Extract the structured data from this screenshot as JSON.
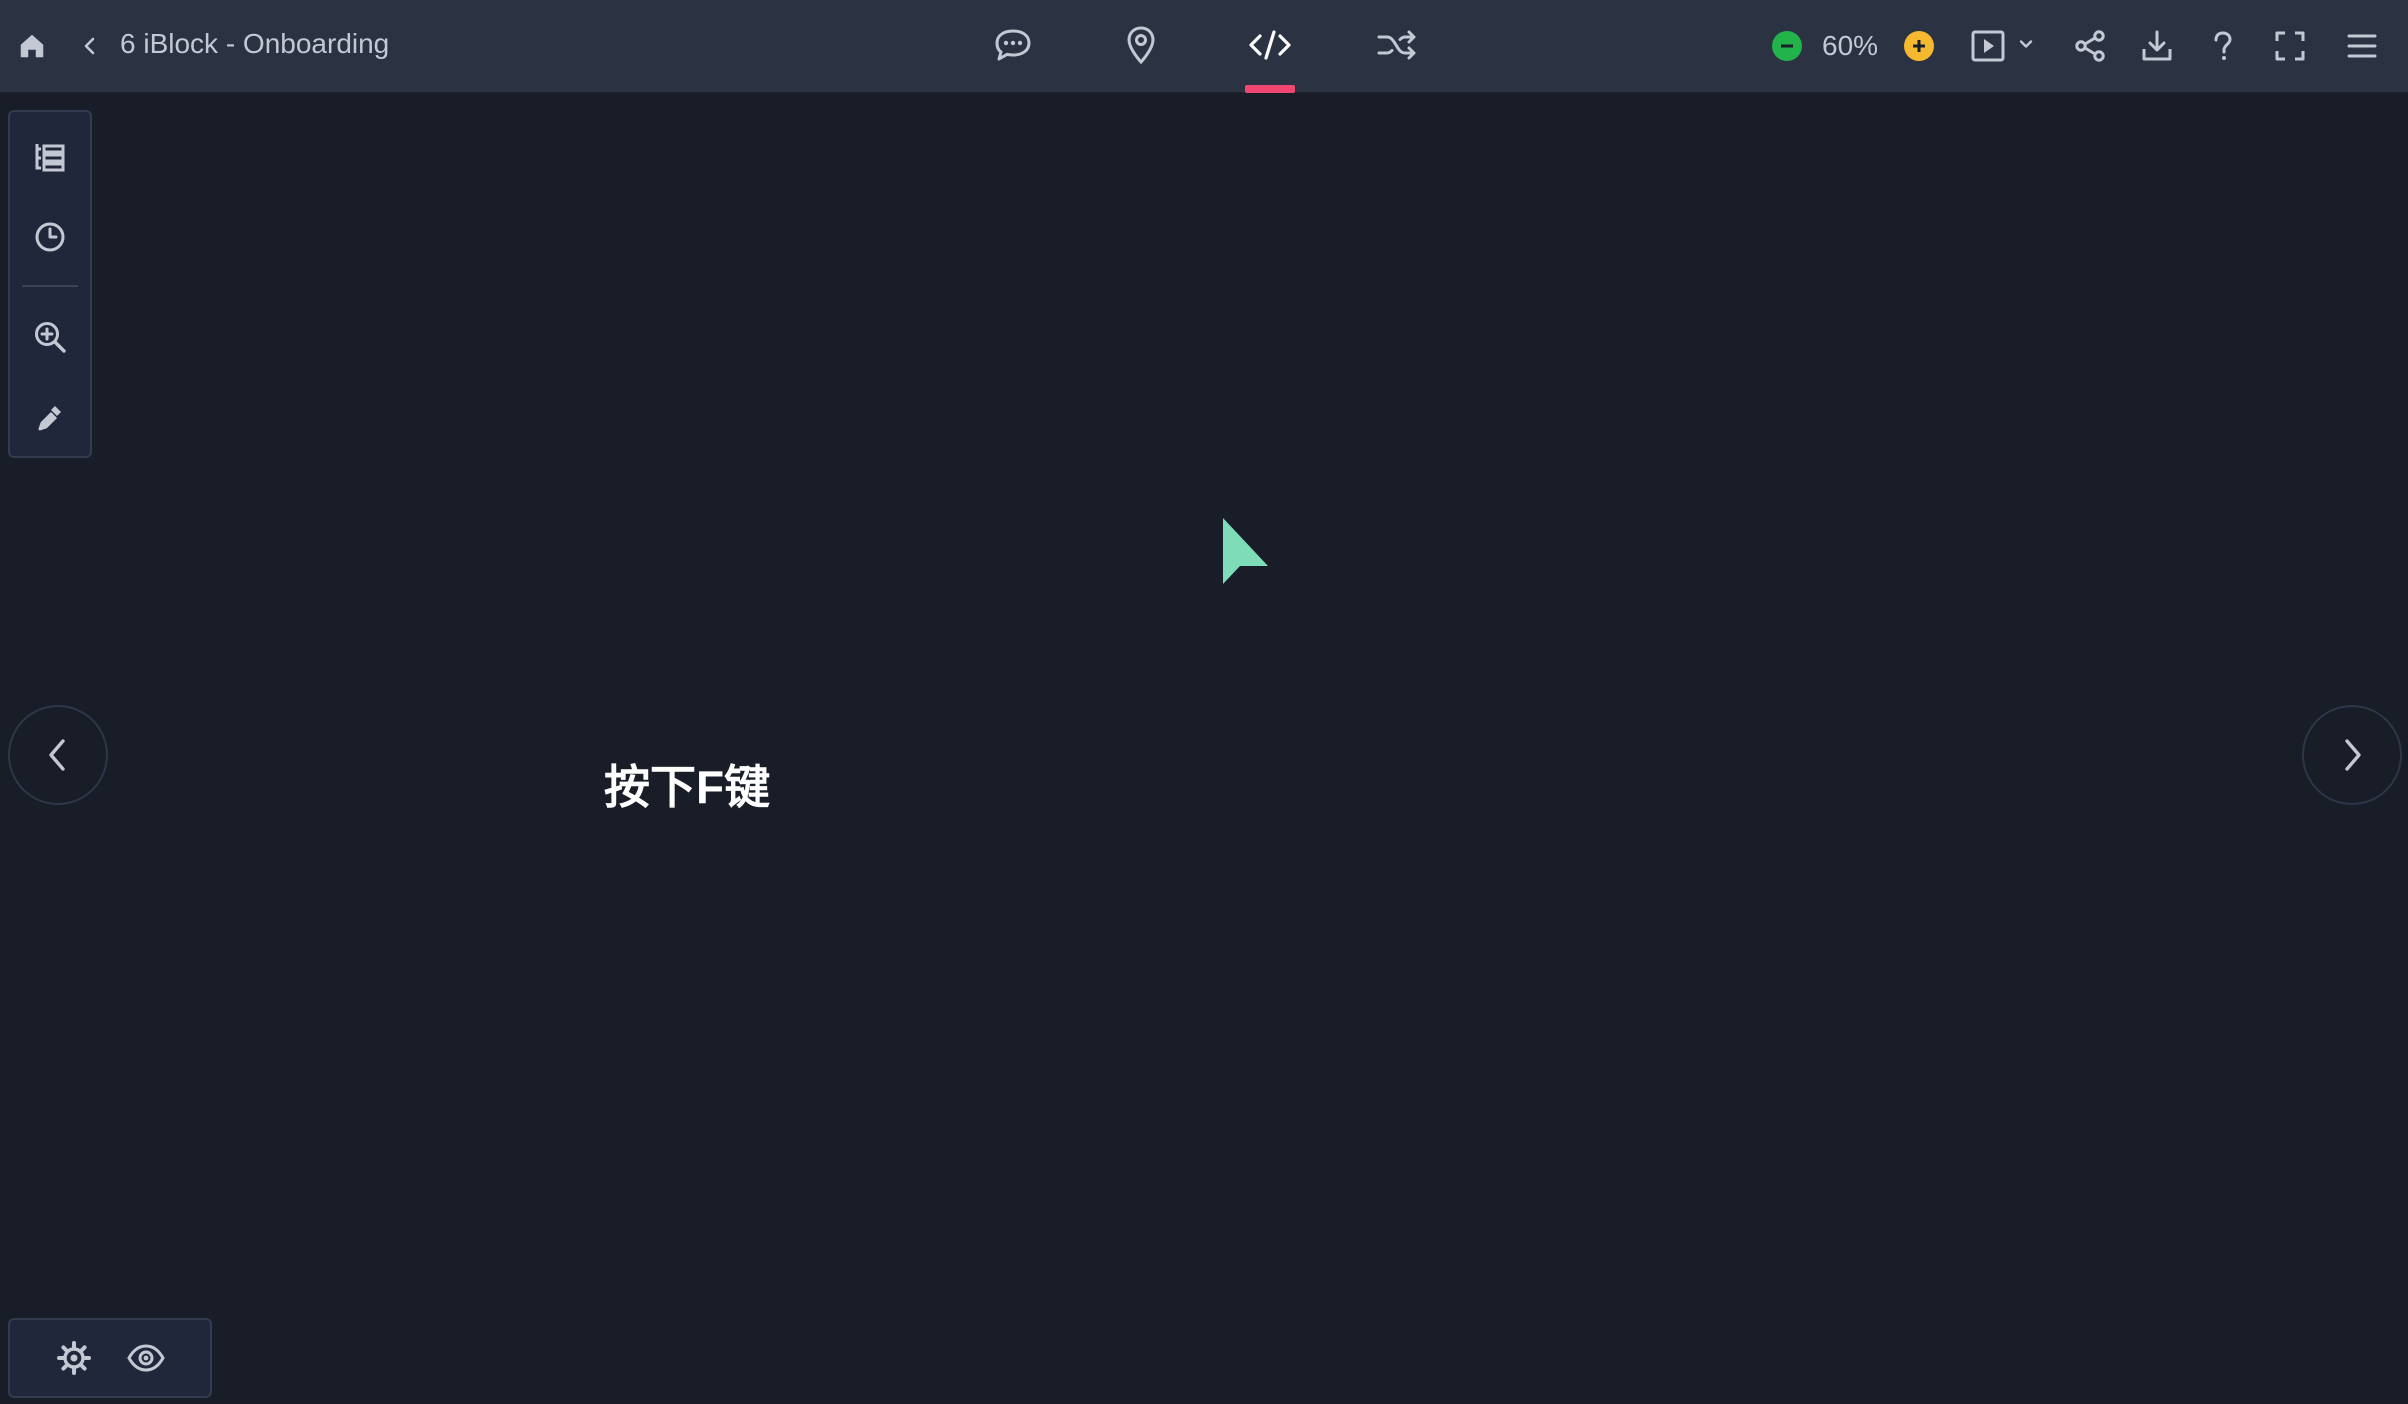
{
  "header": {
    "home_icon": "home-icon",
    "back_icon": "chevron-left-icon",
    "title": "6 iBlock - Onboarding",
    "tabs": [
      {
        "icon": "comment-icon",
        "active": false
      },
      {
        "icon": "map-pin-icon",
        "active": true
      },
      {
        "icon": "code-icon",
        "active": true
      },
      {
        "icon": "shuffle-icon",
        "active": false
      }
    ],
    "zoom": {
      "decrease_icon": "minus-circle-icon",
      "value": "60%",
      "increase_icon": "plus-circle-icon"
    },
    "actions": [
      "play-icon",
      "chevron-down-icon",
      "share-icon",
      "download-icon",
      "help-icon",
      "fullscreen-icon",
      "menu-icon"
    ]
  },
  "tools": [
    "outline-icon",
    "history-icon",
    "zoom-in-icon",
    "eyedropper-icon"
  ],
  "canvas": {
    "text": "按下F键"
  },
  "bottom_tools": [
    "settings-icon",
    "preview-eye-icon"
  ],
  "colors": {
    "topbar": "#2b3343",
    "background": "#181d28",
    "accent": "#ef476f",
    "zoom_minus": "#22b34b",
    "zoom_plus": "#f5b82e",
    "cursor": "#7fdcb8"
  }
}
